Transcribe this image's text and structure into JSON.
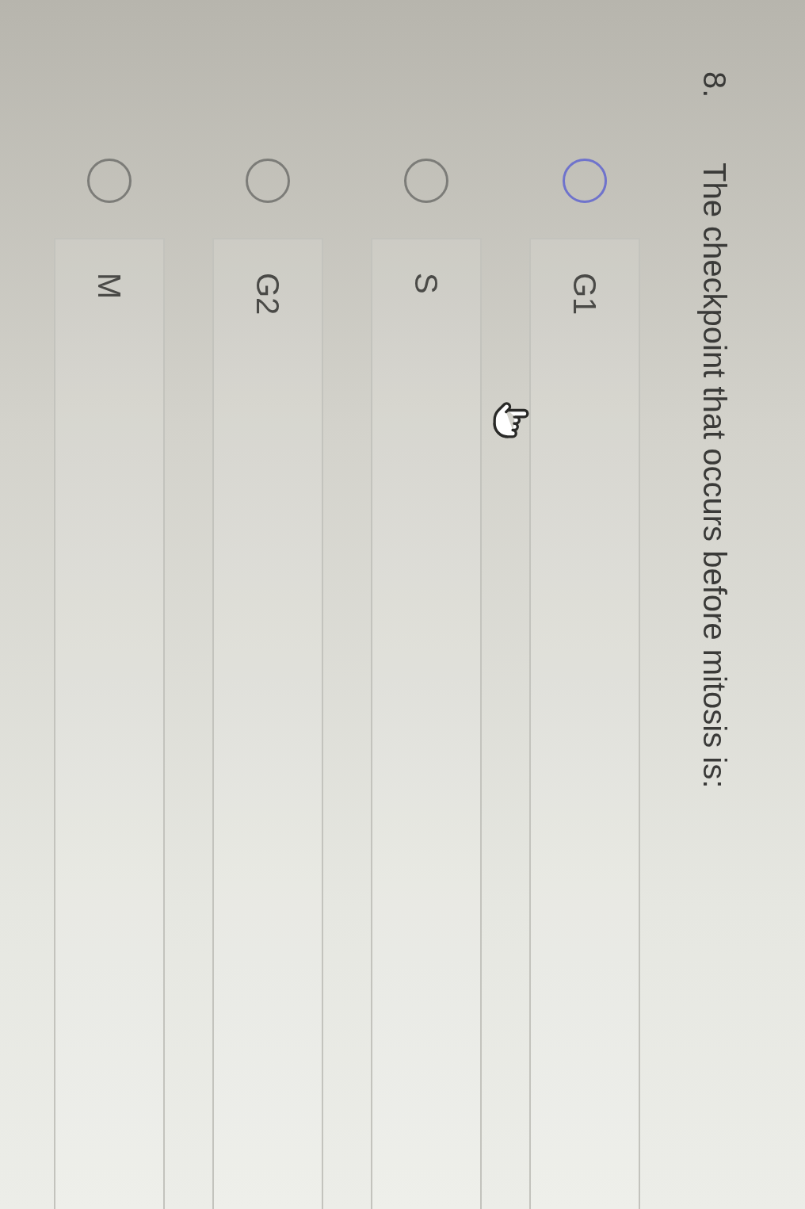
{
  "question": {
    "number": "8.",
    "text": "The checkpoint that occurs before mitosis is:"
  },
  "options": [
    {
      "label": "G1",
      "selected": false,
      "hovered": true
    },
    {
      "label": "S",
      "selected": false,
      "hovered": false
    },
    {
      "label": "G2",
      "selected": false,
      "hovered": false
    },
    {
      "label": "M",
      "selected": false,
      "hovered": false
    }
  ]
}
